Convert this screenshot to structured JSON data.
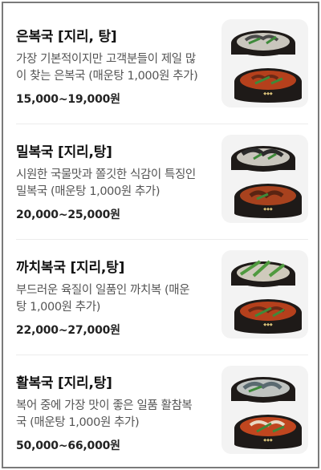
{
  "menu": {
    "items": [
      {
        "name": "은복국 [지리, 탕]",
        "desc_line1": "가장 기본적이지만 고객분들이 제일 많",
        "desc_line2": "이 찾는 은복국 (매운탕 1,000원 추가)",
        "price": "15,000~19,000원",
        "image_icon": "bokguk-stone-pot-photo"
      },
      {
        "name": "밀복국 [지리,탕]",
        "desc_line1": "시원한 국물맛과 쫄깃한 식감이 특징인",
        "desc_line2": "밀복국 (매운탕 1,000원 추가)",
        "price": "20,000~25,000원",
        "image_icon": "bokguk-stone-pot-photo"
      },
      {
        "name": "까치복국 [지리,탕]",
        "desc_line1": "부드러운 육질이 일품인 까치복 (매운",
        "desc_line2": "탕 1,000원 추가)",
        "price": "22,000~27,000원",
        "image_icon": "bokguk-stone-pot-photo"
      },
      {
        "name": "활복국 [지리,탕]",
        "desc_line1": "복어 중에 가장 맛이 좋은 일품 활참복",
        "desc_line2": "국 (매운탕 1,000원 추가)",
        "price": "50,000~66,000원",
        "image_icon": "bokguk-stone-pot-photo"
      }
    ]
  },
  "colors": {
    "border": "#7a7a7a",
    "pot": "#1e1a18",
    "clear_broth": "#c9c6bd",
    "spicy_broth": "#b5401c"
  }
}
